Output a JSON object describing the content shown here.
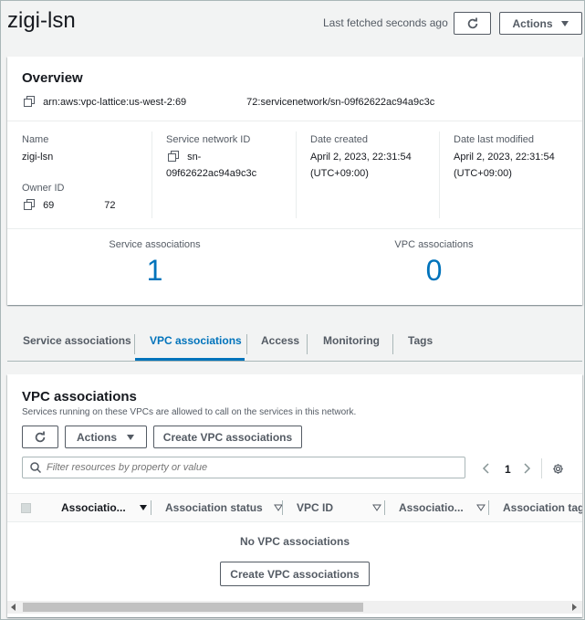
{
  "header": {
    "title": "zigi-lsn",
    "last_fetched": "Last fetched seconds ago",
    "actions_label": "Actions"
  },
  "overview": {
    "title": "Overview",
    "arn": "arn:aws:vpc-lattice:us-west-2:69      72:servicenetwork/sn-09f62622ac94a9c3c",
    "name_label": "Name",
    "name_value": "zigi-lsn",
    "owner_label": "Owner ID",
    "owner_value": "69     72",
    "sn_id_label": "Service network ID",
    "sn_id_value_line1": "sn-",
    "sn_id_value_line2": "09f62622ac94a9c3c",
    "created_label": "Date created",
    "created_line1": "April 2, 2023, 22:31:54",
    "created_line2": "(UTC+09:00)",
    "modified_label": "Date last modified",
    "modified_line1": "April 2, 2023, 22:31:54",
    "modified_line2": "(UTC+09:00)",
    "service_assoc_label": "Service associations",
    "service_assoc_count": "1",
    "vpc_assoc_label": "VPC associations",
    "vpc_assoc_count": "0"
  },
  "tabs": [
    {
      "label": "Service associations",
      "active": false
    },
    {
      "label": "VPC associations",
      "active": true
    },
    {
      "label": "Access",
      "active": false
    },
    {
      "label": "Monitoring",
      "active": false
    },
    {
      "label": "Tags",
      "active": false
    }
  ],
  "vpc_panel": {
    "title": "VPC associations",
    "description": "Services running on these VPCs are allowed to call on the services in this network.",
    "actions_label": "Actions",
    "create_label": "Create VPC associations",
    "search_placeholder": "Filter resources by property or value",
    "page_number": "1",
    "columns": [
      "Associatio...",
      "Association status",
      "VPC ID",
      "Associatio...",
      "Association tags"
    ],
    "empty_text": "No VPC associations",
    "empty_create_label": "Create VPC associations"
  },
  "colors": {
    "accent": "#0073bb",
    "text": "#16191f",
    "muted": "#545b64"
  }
}
